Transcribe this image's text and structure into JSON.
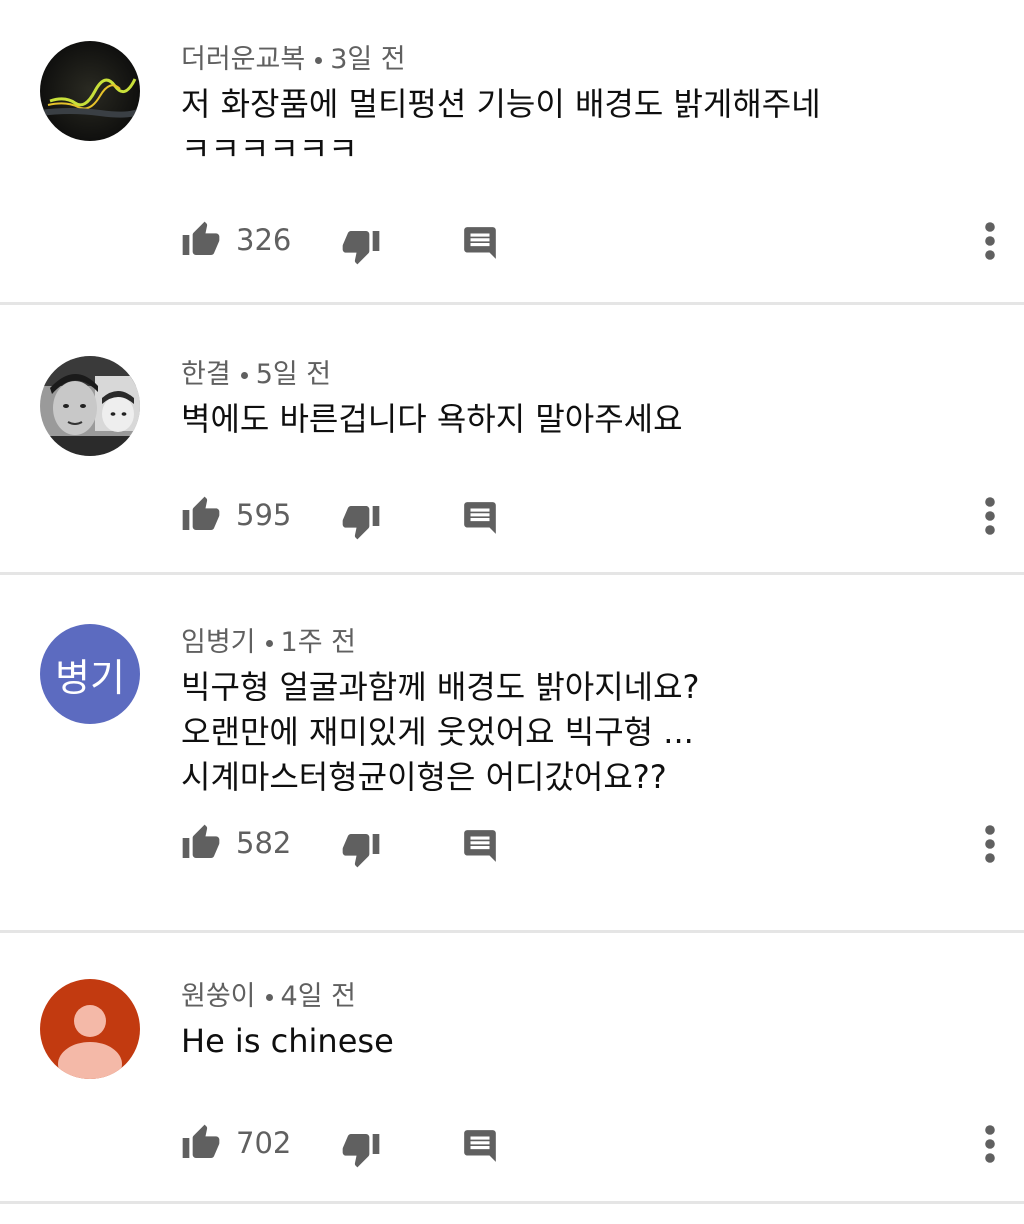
{
  "colors": {
    "text_primary": "#0f0f0f",
    "text_secondary": "#606060",
    "divider": "#e5e5e5",
    "avatar_initials_bg": "#5c6bc0",
    "avatar_default_bg": "#c23a10"
  },
  "comments": [
    {
      "author": "더러운교복",
      "time": "3일 전",
      "lines": [
        "저 화장품에 멀티펑션 기능이 배경도 밝게해주네",
        "ㅋㅋㅋㅋㅋㅋ"
      ],
      "likes": "326",
      "avatar_type": "photo-light-trail"
    },
    {
      "author": "한결",
      "time": "5일 전",
      "lines": [
        "벽에도 바른겁니다 욕하지 말아주세요"
      ],
      "likes": "595",
      "avatar_type": "photo-bw-faces"
    },
    {
      "author": "임병기",
      "time": "1주 전",
      "lines": [
        "빅구형 얼굴과함께 배경도 밝아지네요?",
        "오랜만에 재미있게 웃었어요 빅구형 ...",
        "시계마스터형균이형은 어디갔어요??"
      ],
      "likes": "582",
      "avatar_type": "initials",
      "avatar_initials": "병기"
    },
    {
      "author": "원쑹이",
      "time": "4일 전",
      "lines": [
        "He is chinese"
      ],
      "likes": "702",
      "avatar_type": "default-person"
    }
  ]
}
